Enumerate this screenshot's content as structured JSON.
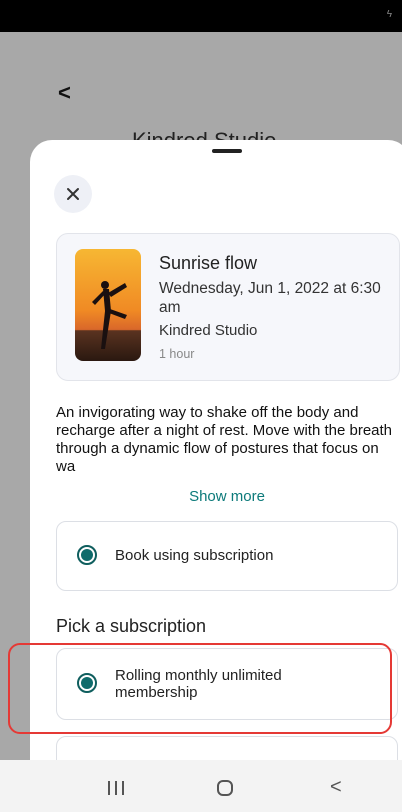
{
  "background": {
    "studio_name": "Kindred Studio"
  },
  "sheet": {
    "class": {
      "title": "Sunrise flow",
      "datetime": "Wednesday, Jun 1, 2022 at 6:30 am",
      "studio": "Kindred Studio",
      "duration": "1 hour"
    },
    "description": "An invigorating way to shake off the body and recharge after a night of rest. Move with the breath through a dynamic flow of postures that focus on wa",
    "show_more_label": "Show more",
    "booking_option": {
      "label": "Book using subscription",
      "selected": true
    },
    "subscription_heading": "Pick a subscription",
    "subscription_option": {
      "label": "Rolling monthly unlimited membership",
      "selected": true
    }
  },
  "colors": {
    "accent": "#0c7a7a",
    "highlight": "#e53935"
  },
  "icons": {
    "close": "close-icon",
    "back": "back-arrow-icon",
    "nav_recents": "recents-icon",
    "nav_home": "home-icon",
    "nav_back": "nav-back-icon"
  }
}
